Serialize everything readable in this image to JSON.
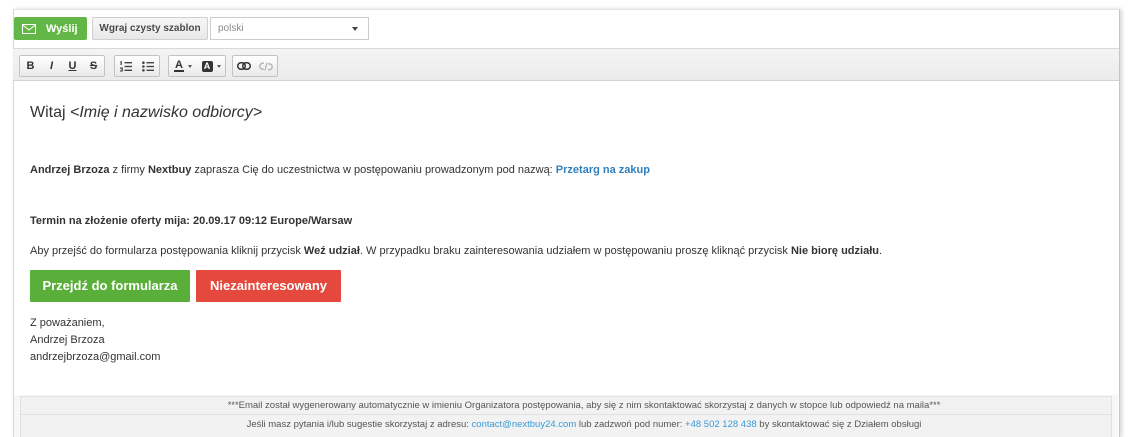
{
  "toolbar": {
    "send_button": {
      "label": "Wyślij",
      "icon": "envelope-icon"
    },
    "template_button": {
      "label": "Wgraj czysty szablon"
    },
    "language_select": {
      "selected": "polski",
      "icon": "caret-down-icon"
    }
  },
  "format_toolbar": {
    "bold": "B",
    "italic": "I",
    "underline": "U",
    "strikethrough": "S",
    "ordered_list_icon": "ordered-list-icon",
    "bullet_list_icon": "bullet-list-icon",
    "text_color": "A",
    "background_color": "A",
    "link_icon": "link-icon",
    "unlink_icon": "unlink-icon"
  },
  "email": {
    "greeting": {
      "word": "Witaj",
      "placeholder": "<Imię i nazwisko odbiorcy>"
    },
    "invitation": {
      "sender": "Andrzej Brzoza",
      "text_1": " z firmy ",
      "company": "Nextbuy",
      "text_2": " zaprasza Cię do uczestnictwa w postępowaniu prowadzonym pod nazwą: ",
      "tender_link": "Przetarg na zakup"
    },
    "deadline": {
      "label": "Termin na złożenie oferty mija:",
      "value": "20.09.17 09:12 Europe/Warsaw"
    },
    "instructions": {
      "text_1": "Aby przejść do formularza postępowania kliknij przycisk ",
      "participate_name": "Weź udział",
      "text_2": ". W przypadku braku zainteresowania udziałem w postępowaniu proszę kliknąć przycisk ",
      "decline_name": "Nie biorę udziału",
      "text_3": "."
    },
    "buttons": {
      "participate": "Przejdź do formularza",
      "decline": "Niezainteresowany"
    },
    "signature": {
      "closing": "Z poważaniem,",
      "name": "Andrzej Brzoza",
      "email": "andrzejbrzoza@gmail.com"
    }
  },
  "footer": {
    "notice": "***Email został wygenerowany automatycznie w imieniu Organizatora postępowania, aby się z nim skontaktować skorzystaj z danych w stopce lub odpowiedź na maila***",
    "contact": {
      "text_1": "Jeśli masz pytania i/lub sugestie skorzystaj z adresu: ",
      "email_link": "contact@nextbuy24.com",
      "text_2": " lub zadzwoń pod numer: ",
      "phone_link": "+48 502 128 438",
      "text_3": " by skontaktować się z Działem obsługi"
    }
  },
  "colors": {
    "send_green": "#63b746",
    "cta_green": "#5aaf3b",
    "cta_red": "#e5493d",
    "link_blue": "#2f80bd",
    "footer_link": "#3a9ad6",
    "text": "#333333"
  }
}
